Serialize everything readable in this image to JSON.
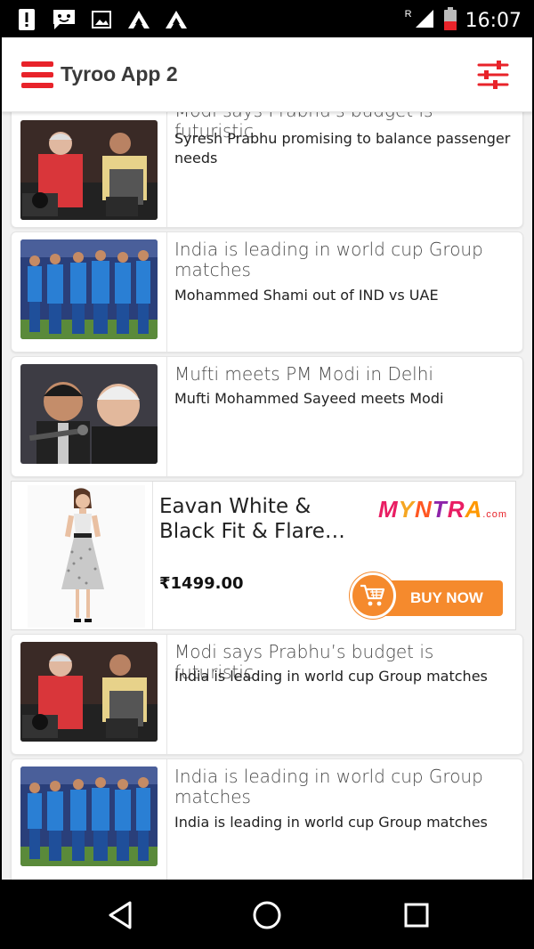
{
  "status_bar": {
    "time": "16:07",
    "roaming": "R"
  },
  "app_bar": {
    "title": "Tyroo App 2"
  },
  "articles": [
    {
      "headline": "Modi says Prabhu's budget is futuristic",
      "subline": "Syresh Prabhu promising to balance passenger needs",
      "image": "politicians-photo"
    },
    {
      "headline": "India is leading in world cup Group matches",
      "subline": "Mohammed Shami out of IND vs UAE",
      "image": "cricket-team-photo"
    },
    {
      "headline": "Mufti meets PM Modi in Delhi",
      "subline": "Mufti Mohammed Sayeed meets Modi",
      "image": "mufti-photo"
    },
    {
      "headline": "Modi says Prabhu’s budget is futuristic",
      "subline": "India is leading in world cup Group matches",
      "image": "politicians-photo"
    },
    {
      "headline": "India is leading in world cup Group matches",
      "subline": "India is leading in world cup Group matches",
      "image": "cricket-team-photo"
    }
  ],
  "ad": {
    "title": "Eavan White & Black Fit & Flare…",
    "price": "₹1499.00",
    "brand": "MYNTRA",
    "brand_suffix": ".com",
    "cta": "BUY NOW",
    "accent_color": "#f58a2d"
  },
  "colors": {
    "accent": "#e8232a"
  }
}
